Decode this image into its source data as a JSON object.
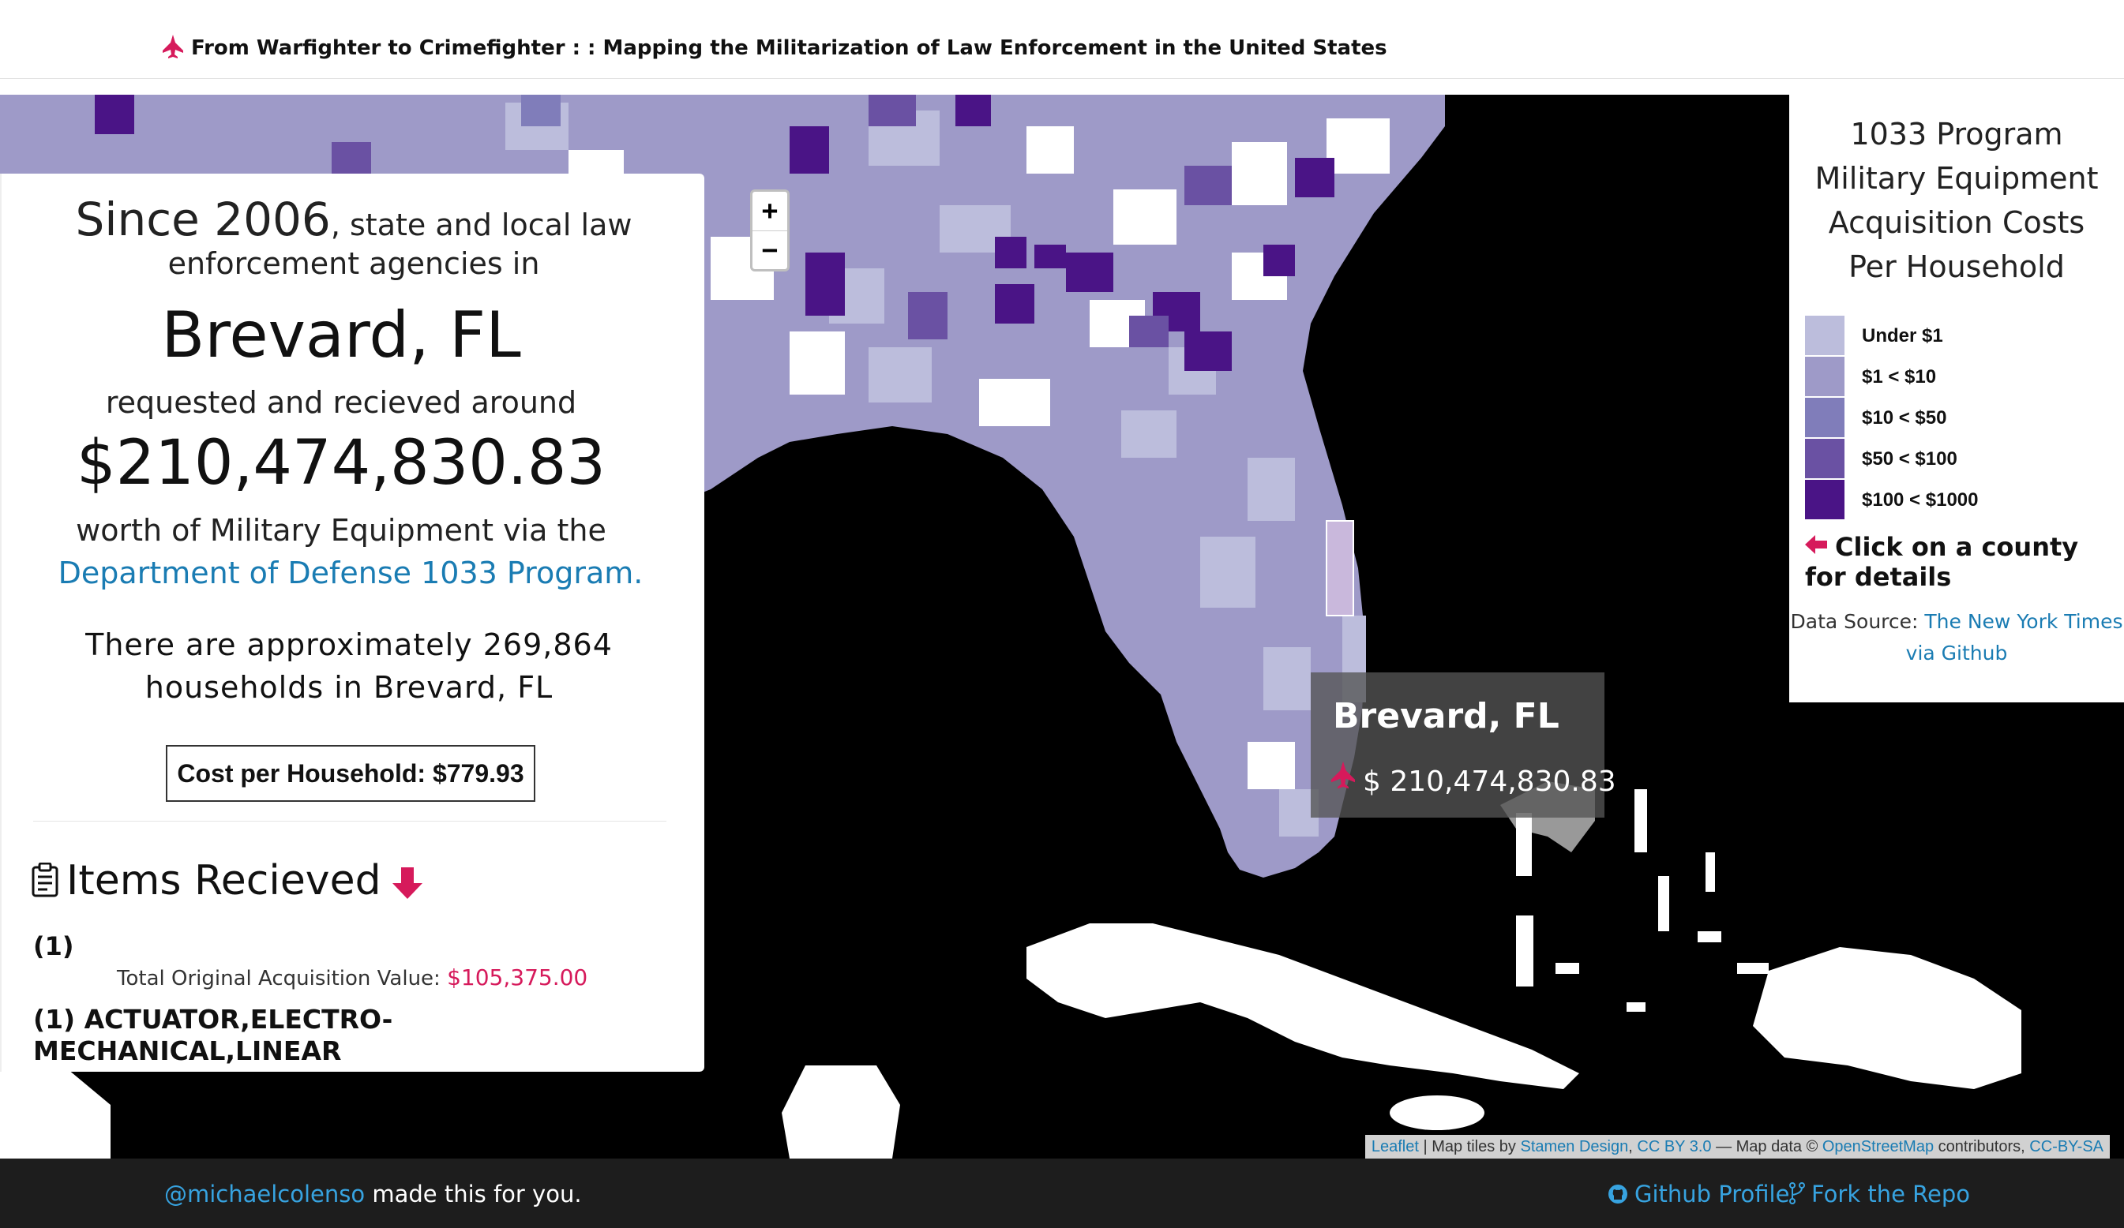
{
  "header": {
    "title": "From Warfighter to Crimefighter : : Mapping the Militarization of Law Enforcement in the United States",
    "icon": "fighter-jet-icon",
    "accent": "#d61a5b"
  },
  "map": {
    "zoom_in": "+",
    "zoom_out": "−",
    "background": "#000000"
  },
  "info": {
    "since_year": "Since 2006",
    "since_rest": ", state and local law",
    "agencies_line": "enforcement agencies in",
    "county": "Brevard, FL",
    "requested_line": "requested and recieved around",
    "amount": "$210,474,830.83",
    "worth_line": "worth of Military Equipment via the",
    "program_link": "Department of Defense 1033 Program.",
    "households_line1": "There are approximately 269,864",
    "households_line2": "households in Brevard, FL",
    "cost_per_household": "Cost per Household: $779.93",
    "items_heading": "Items Recieved",
    "items": [
      {
        "qty": "(1)",
        "value_label": "Total Original Acquisition Value:",
        "value": "$105,375.00",
        "name": "(1) ACTUATOR,ELECTRO-MECHANICAL,LINEAR"
      }
    ]
  },
  "legend": {
    "title_lines": [
      "1033 Program",
      "Military Equipment",
      "Acquisition Costs",
      "Per Household"
    ],
    "bins": [
      {
        "label": "Under $1",
        "color": "#bcbddc"
      },
      {
        "label": "$1 < $10",
        "color": "#9e9ac8"
      },
      {
        "label": "$10 < $50",
        "color": "#807dba"
      },
      {
        "label": "$50 < $100",
        "color": "#6a51a3"
      },
      {
        "label": "$100 < $1000",
        "color": "#4a1486"
      }
    ],
    "click_hint": "Click on a county for details",
    "source_label": "Data Source:",
    "source_link": "The New York Times via Github"
  },
  "tooltip": {
    "county": "Brevard, FL",
    "amount": "$ 210,474,830.83"
  },
  "attribution": {
    "leaflet": "Leaflet",
    "tiles_by": "| Map tiles by",
    "stamen": "Stamen Design",
    "cc": "CC BY 3.0",
    "mapdata": "— Map data ©",
    "osm": "OpenStreetMap",
    "contributors": "contributors,",
    "ccbysa": "CC-BY-SA"
  },
  "footer": {
    "handle": "@michaelcolenso",
    "made_text": " made this for you.",
    "github": "Github Profile",
    "fork": "Fork the Repo"
  }
}
